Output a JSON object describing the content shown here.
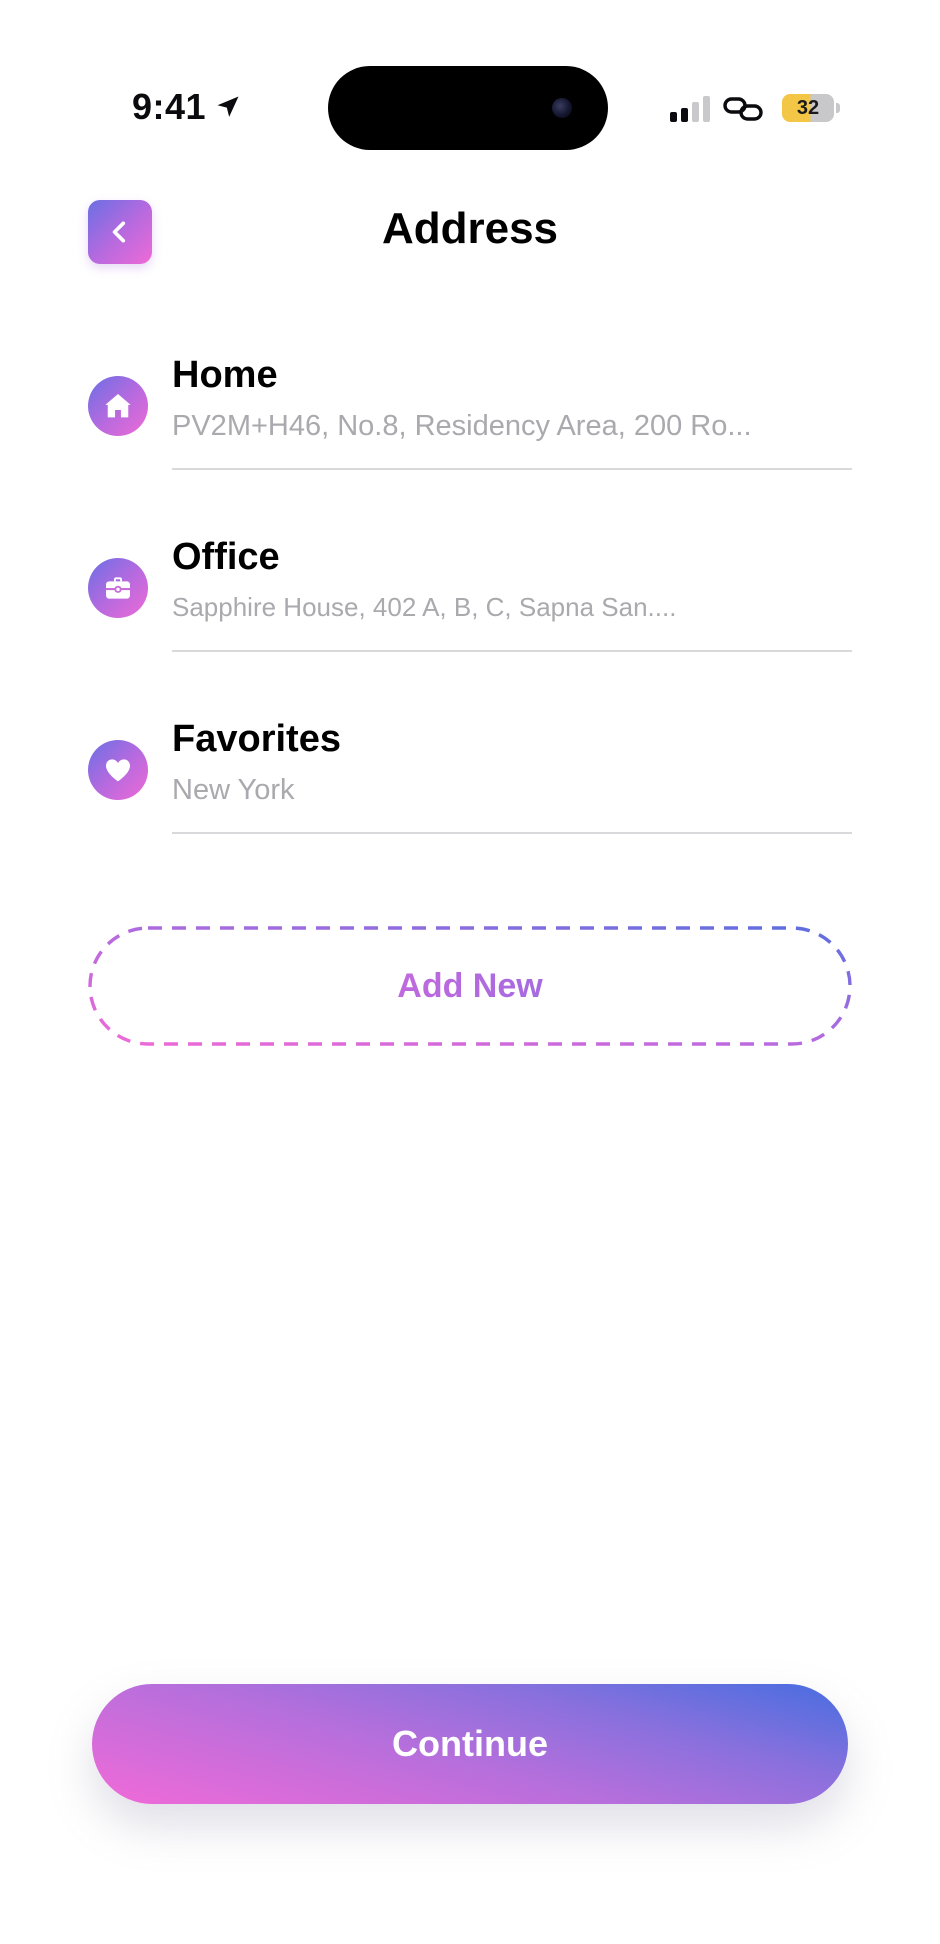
{
  "status_bar": {
    "time": "9:41",
    "battery_level": "32",
    "icons": [
      "location-arrow-icon",
      "signal-icon",
      "link-icon",
      "battery-icon"
    ]
  },
  "header": {
    "title": "Address",
    "back_icon": "chevron-left-icon"
  },
  "addresses": [
    {
      "name": "Home",
      "line": "PV2M+H46, No.8, Residency Area, 200 Ro...",
      "icon": "home-icon"
    },
    {
      "name": "Office",
      "line": "Sapphire House, 402 A, B, C, Sapna San....",
      "icon": "briefcase-icon"
    },
    {
      "name": "Favorites",
      "line": "New York",
      "icon": "heart-icon"
    }
  ],
  "add_new": {
    "label": "Add New"
  },
  "footer": {
    "continue_label": "Continue"
  },
  "colors": {
    "gradient_start": "#6a6fe4",
    "gradient_mid": "#b46adf",
    "gradient_end": "#ef6ad6",
    "muted_text": "#a9a9ae",
    "divider": "#d9d9dc"
  }
}
